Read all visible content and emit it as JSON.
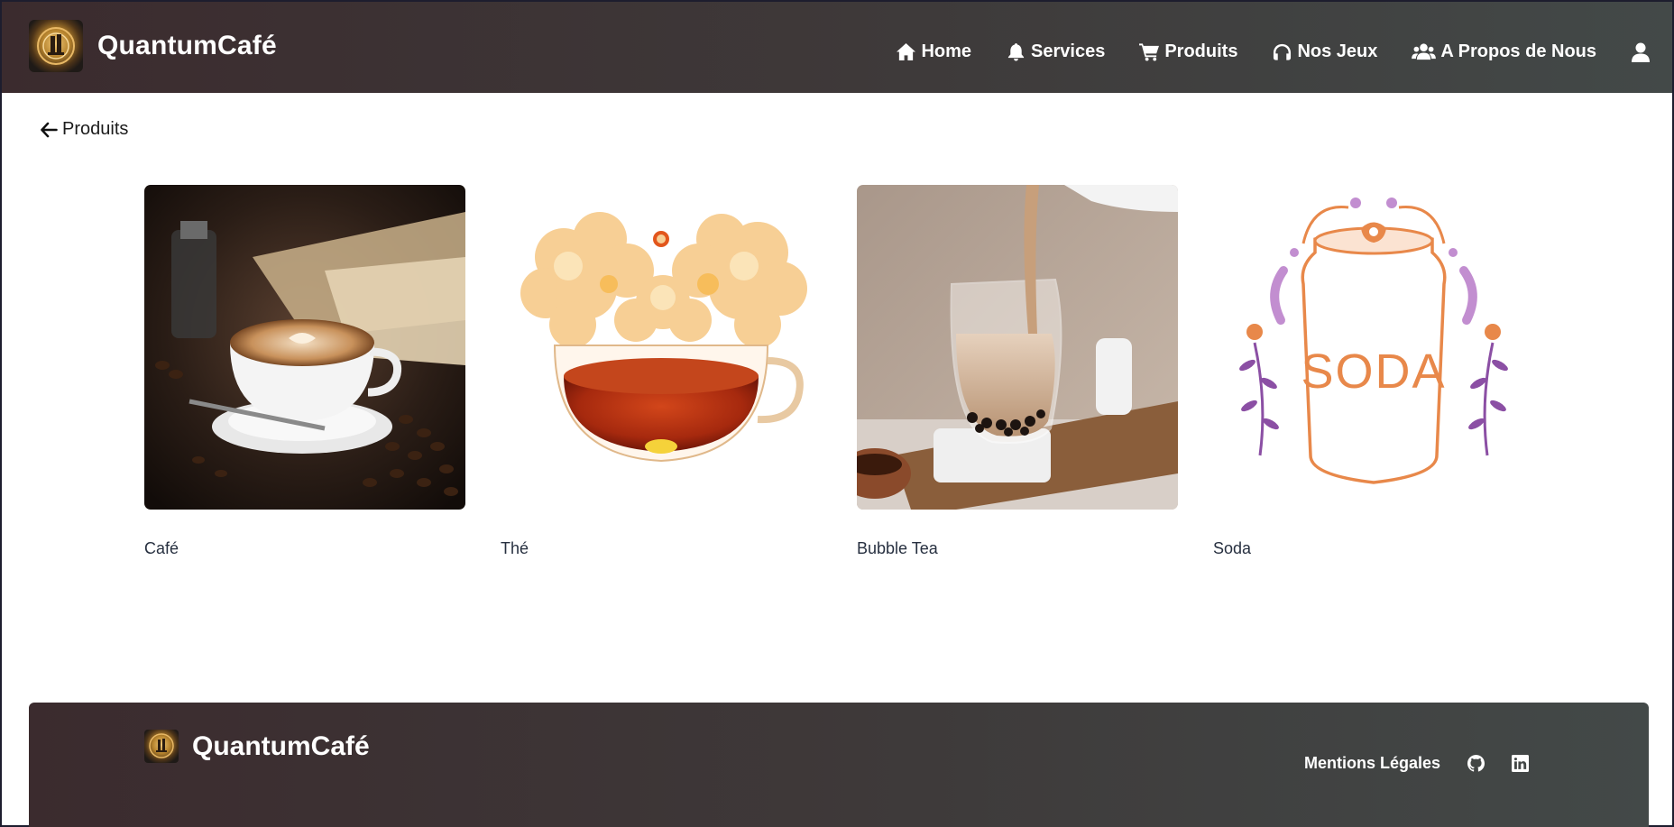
{
  "navbar": {
    "brand": "QuantumCafé",
    "links": [
      {
        "label": "Home",
        "icon": "home-icon"
      },
      {
        "label": "Services",
        "icon": "bell-icon"
      },
      {
        "label": "Produits",
        "icon": "cart-icon"
      },
      {
        "label": "Nos Jeux",
        "icon": "headphones-icon"
      },
      {
        "label": "A Propos de Nous",
        "icon": "users-icon"
      }
    ],
    "user_icon": "user-icon"
  },
  "back_link": {
    "label": "Produits",
    "icon": "arrow-left-icon"
  },
  "products": [
    {
      "name": "Café"
    },
    {
      "name": "Thé"
    },
    {
      "name": "Bubble Tea"
    },
    {
      "name": "Soda"
    }
  ],
  "footer": {
    "brand": "QuantumCafé",
    "legal": "Mentions Légales",
    "icons": [
      "github-icon",
      "linkedin-icon"
    ]
  },
  "colors": {
    "header_start": "#3b2b2e",
    "header_end": "#434948",
    "label_text": "#273040"
  }
}
